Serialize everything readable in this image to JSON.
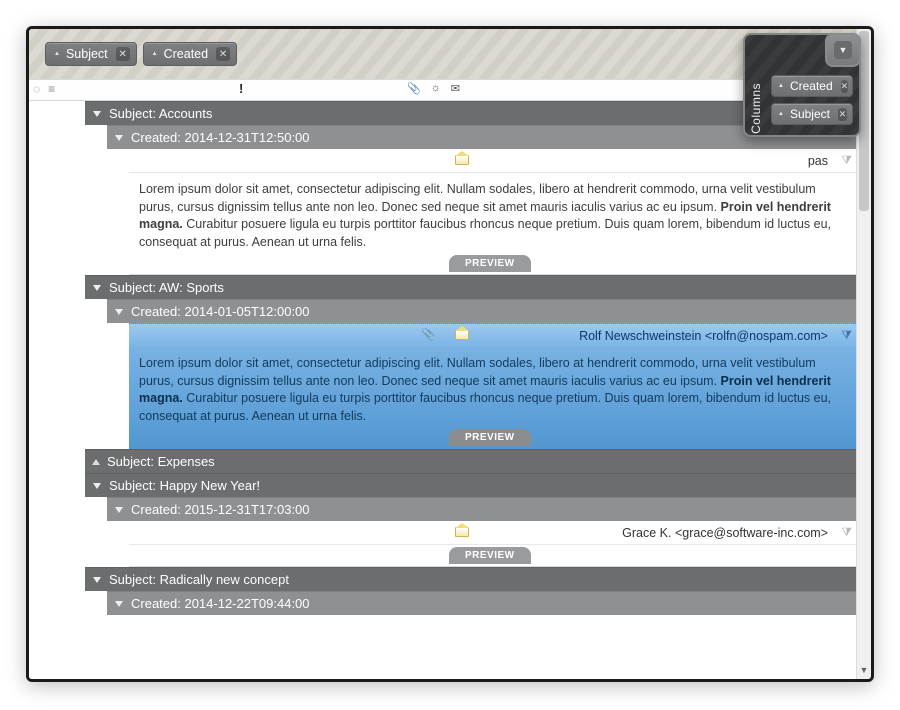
{
  "groupby": {
    "chips": [
      {
        "label": "Subject"
      },
      {
        "label": "Created"
      }
    ]
  },
  "columns_panel": {
    "title": "Columns",
    "chips": [
      {
        "label": "Created"
      },
      {
        "label": "Subject"
      }
    ]
  },
  "groups": [
    {
      "subject_label": "Subject: Accounts",
      "expanded": true,
      "created": {
        "label": "Created: 2014-12-31T12:50:00",
        "expanded": true,
        "row": {
          "has_attachment": false,
          "sender_fragment": "pas",
          "selected": false
        },
        "preview_plain_1": "Lorem ipsum dolor sit amet, consectetur adipiscing elit. Nullam sodales, libero at hendrerit commodo, urna velit vestibulum purus, cursus dignissim tellus ante non leo. Donec sed neque sit amet mauris iaculis varius ac eu ipsum. ",
        "preview_bold": "Proin vel hendrerit magna.",
        "preview_plain_2": " Curabitur posuere ligula eu turpis porttitor faucibus rhoncus neque pretium. Duis quam lorem, bibendum id luctus eu, consequat at purus. Aenean ut urna felis.",
        "preview_tab": "PREVIEW"
      }
    },
    {
      "subject_label": "Subject: AW: Sports",
      "expanded": true,
      "created": {
        "label": "Created: 2014-01-05T12:00:00",
        "expanded": true,
        "row": {
          "has_attachment": true,
          "sender": "Rolf Newschweinstein <rolfn@nospam.com>",
          "selected": true
        },
        "preview_plain_1": "Lorem ipsum dolor sit amet, consectetur adipiscing elit. Nullam sodales, libero at hendrerit commodo, urna velit vestibulum purus, cursus dignissim tellus ante non leo. Donec sed neque sit amet mauris iaculis varius ac eu ipsum. ",
        "preview_bold": "Proin vel hendrerit magna.",
        "preview_plain_2": " Curabitur posuere ligula eu turpis porttitor faucibus rhoncus neque pretium. Duis quam lorem, bibendum id luctus eu, consequat at purus. Aenean ut urna felis.",
        "preview_tab": "PREVIEW"
      }
    },
    {
      "subject_label": "Subject: Expenses",
      "expanded": false
    },
    {
      "subject_label": "Subject: Happy New Year!",
      "expanded": true,
      "created": {
        "label": "Created: 2015-12-31T17:03:00",
        "expanded": true,
        "row": {
          "has_attachment": false,
          "sender": "Grace K. <grace@software-inc.com>",
          "selected": false
        },
        "preview_tab": "PREVIEW"
      }
    },
    {
      "subject_label": "Subject: Radically new concept",
      "expanded": true,
      "created": {
        "label": "Created: 2014-12-22T09:44:00",
        "expanded": true
      }
    }
  ]
}
